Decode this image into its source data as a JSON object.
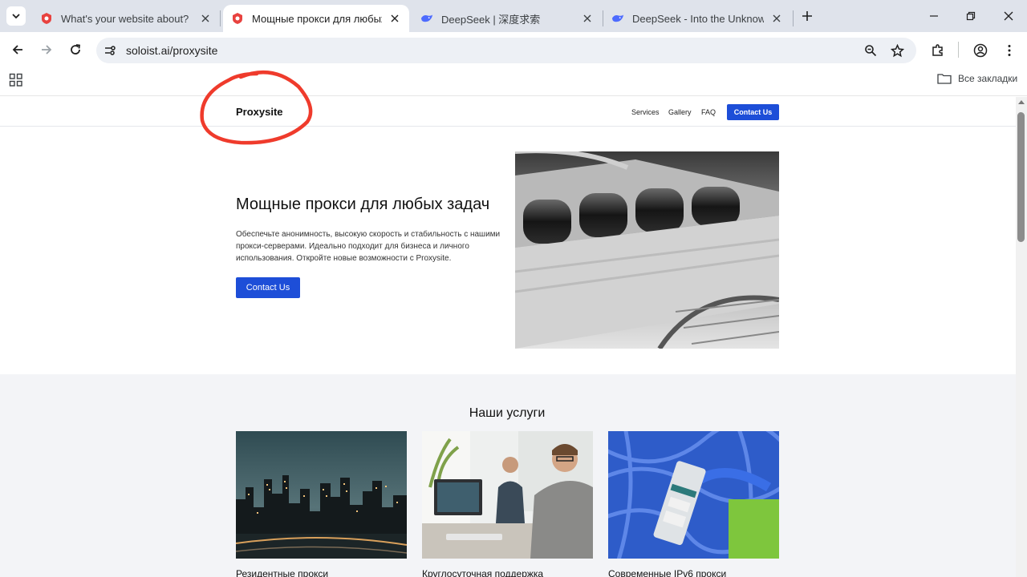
{
  "browser": {
    "tabs": [
      {
        "title": "What's your website about?",
        "active": false
      },
      {
        "title": "Мощные прокси для любых задач",
        "active": true
      },
      {
        "title": "DeepSeek | 深度求索",
        "active": false
      },
      {
        "title": "DeepSeek - Into the Unknown",
        "active": false
      }
    ],
    "url": "soloist.ai/proxysite",
    "bookmarks_all": "Все закладки",
    "colors": {
      "tabstrip": "#dfe3eb",
      "omnibox": "#edf0f5",
      "deepseek_blue": "#4d6bfe",
      "soloist_red": "#e8423f"
    }
  },
  "site": {
    "logo": "Proxysite",
    "nav": [
      "Services",
      "Gallery",
      "FAQ"
    ],
    "header_cta": "Contact Us",
    "hero": {
      "title": "Мощные прокси для любых задач",
      "text": "Обеспечьте анонимность, высокую скорость и стабильность с нашими прокси-серверами. Идеально подходит для бизнеса и личного использования. Откройте новые возможности с Proxysite.",
      "cta": "Contact Us"
    },
    "services": {
      "title": "Наши услуги",
      "cards": [
        {
          "title": "Резидентные прокси"
        },
        {
          "title": "Круглосуточная поддержка"
        },
        {
          "title": "Современные IPv6 прокси"
        }
      ]
    },
    "colors": {
      "accent": "#1d4ed8",
      "annotation": "#ef3b2c"
    }
  }
}
